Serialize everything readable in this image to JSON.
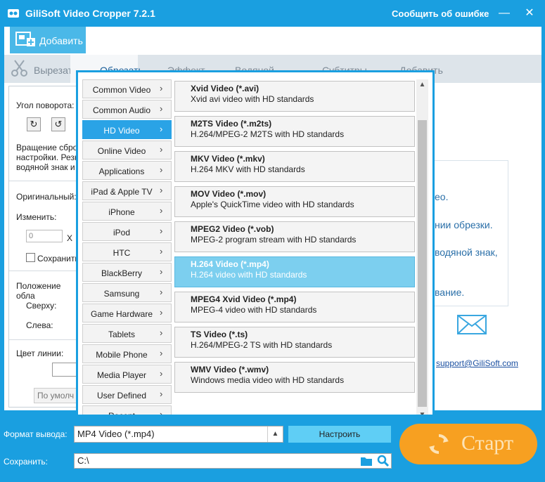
{
  "window": {
    "title": "GiliSoft Video Cropper 7.2.1",
    "report_link": "Сообщить об ошибке",
    "minimize": "—",
    "close": "✕"
  },
  "add_button": {
    "label": "Добавить"
  },
  "toolbar": [
    {
      "label": "Вырезать",
      "icon": "scissors-icon"
    },
    {
      "label": "Обрезать",
      "icon": "crop-icon"
    },
    {
      "label": "Эффект",
      "icon": "effect-icon"
    },
    {
      "label": "Водяной знак",
      "icon": "watermark-icon"
    },
    {
      "label": "Субтитры",
      "icon": "subtitle-icon"
    },
    {
      "label": "Добавить",
      "icon": "add-audio-icon"
    }
  ],
  "left_panel": {
    "rotation_label": "Угол поворота:",
    "rotate_note": "Вращение сбросит\nнастройки. Резка,\nводяной знак и с",
    "original_label": "Оригинальный:",
    "resize_label": "Изменить:",
    "width_value": "0",
    "x_sep": "X",
    "keep_label": "Сохранить",
    "position_label": "Положение обла",
    "top_label": "Сверху:",
    "left_label": "Слева:",
    "line_color_label": "Цвет линии:",
    "default_button": "По умолч"
  },
  "info_panel": {
    "lines": [
      "ео.",
      "нии обрезки.",
      "водяной знак,",
      "вание."
    ],
    "support_link": "support@GiliSoft.com"
  },
  "format_popup": {
    "categories": [
      "Common Video",
      "Common Audio",
      "HD Video",
      "Online Video",
      "Applications",
      "iPad & Apple TV",
      "iPhone",
      "iPod",
      "HTC",
      "BlackBerry",
      "Samsung",
      "Game Hardware",
      "Tablets",
      "Mobile Phone",
      "Media Player",
      "User Defined",
      "Recent"
    ],
    "selected_category": "HD Video",
    "formats": [
      {
        "name": "Xvid Video (*.avi)",
        "desc": "Xvid avi video with HD standards"
      },
      {
        "name": "M2TS Video (*.m2ts)",
        "desc": "H.264/MPEG-2 M2TS with HD standards"
      },
      {
        "name": "MKV Video (*.mkv)",
        "desc": "H.264 MKV with HD standards"
      },
      {
        "name": "MOV Video (*.mov)",
        "desc": "Apple's QuickTime video with HD standards"
      },
      {
        "name": "MPEG2 Video (*.vob)",
        "desc": "MPEG-2 program stream with HD standards"
      },
      {
        "name": "H.264 Video (*.mp4)",
        "desc": "H.264 video with HD standards"
      },
      {
        "name": "MPEG4 Xvid Video (*.mp4)",
        "desc": "MPEG-4 video with HD standards"
      },
      {
        "name": "TS Video (*.ts)",
        "desc": "H.264/MPEG-2 TS with HD standards"
      },
      {
        "name": "WMV Video (*.wmv)",
        "desc": "Windows media video with HD standards"
      }
    ],
    "selected_format": "H.264 Video (*.mp4)"
  },
  "bottom": {
    "output_format_label": "Формат вывода:",
    "output_format_value": "MP4 Video (*.mp4)",
    "configure_button": "Настроить",
    "save_label": "Сохранить:",
    "save_path": "C:\\",
    "start_button": "Старт"
  },
  "colors": {
    "accent": "#1a9fe0",
    "start": "#f7a021",
    "selected": "#2aa3e6"
  }
}
